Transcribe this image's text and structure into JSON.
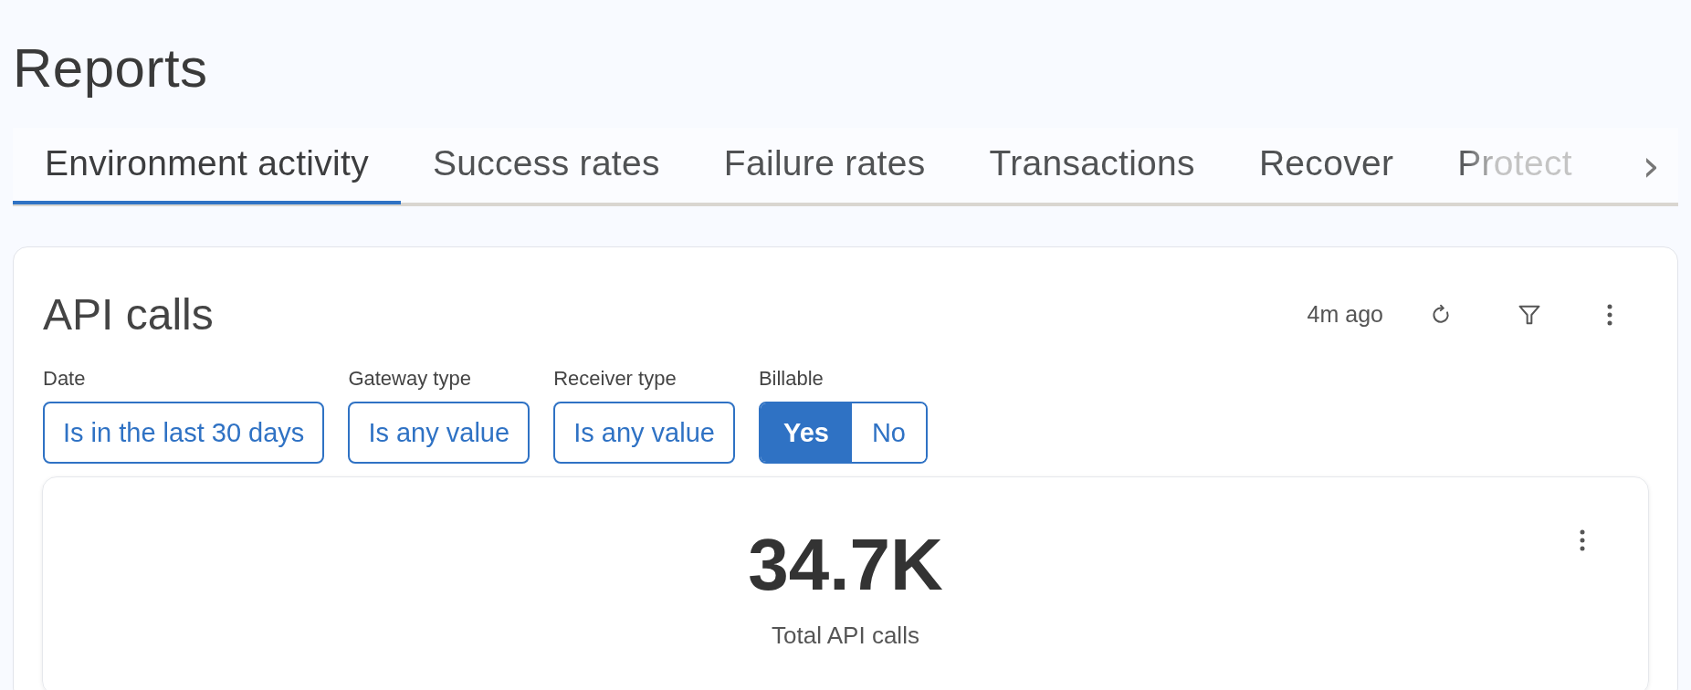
{
  "page_title": "Reports",
  "tabs": [
    {
      "label": "Environment activity",
      "selected": true
    },
    {
      "label": "Success rates",
      "selected": false
    },
    {
      "label": "Failure rates",
      "selected": false
    },
    {
      "label": "Transactions",
      "selected": false
    },
    {
      "label": "Recover",
      "selected": false
    },
    {
      "label": "Protect",
      "selected": false
    }
  ],
  "tabs_scroll": {
    "symbol": "›"
  },
  "card": {
    "title": "API calls",
    "updated": "4m ago",
    "filters": [
      {
        "label": "Date",
        "kind": "select",
        "value": "Is in the last 30 days"
      },
      {
        "label": "Gateway type",
        "kind": "select",
        "value": "Is any value"
      },
      {
        "label": "Receiver type",
        "kind": "select",
        "value": "Is any value"
      },
      {
        "label": "Billable",
        "kind": "toggle",
        "options": [
          {
            "label": "Yes",
            "selected": true
          },
          {
            "label": "No",
            "selected": false
          }
        ]
      }
    ],
    "metric": {
      "value": "34.7K",
      "caption": "Total API calls"
    }
  }
}
